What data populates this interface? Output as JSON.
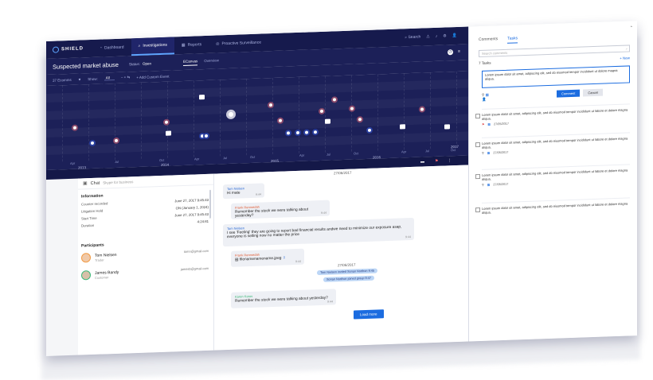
{
  "app": {
    "logo": "SHIELD"
  },
  "nav": [
    {
      "label": "Dashboard",
      "icon": "gauge-icon"
    },
    {
      "label": "Investigations",
      "icon": "search-icon"
    },
    {
      "label": "Reports",
      "icon": "chart-icon"
    },
    {
      "label": "Proactive Surveillance",
      "icon": "radar-icon"
    }
  ],
  "topright": {
    "search": "Search"
  },
  "header": {
    "title": "Suspected market abuse",
    "status_label": "Status:",
    "status_value": "Open",
    "tabs": [
      "ECanvas",
      "Overview"
    ]
  },
  "filters": {
    "ecomms": "37 Ecomms",
    "show": "Show:",
    "show_value": "All",
    "add": "+ Add Custom Event"
  },
  "timeline": {
    "months": [
      "Apr",
      "Jul",
      "Oct",
      "Jan",
      "Apr",
      "Jul",
      "Oct",
      "Jan",
      "Apr",
      "Jul",
      "Oct",
      "Jan",
      "Apr",
      "Jul",
      "Oct",
      "Jan",
      "Apr",
      "Jul",
      "Oct",
      "Jan",
      "Apr"
    ],
    "years": [
      "2013",
      "2014",
      "2015",
      "2016",
      "2017"
    ]
  },
  "chat": {
    "title": "Chat",
    "subtitle": "Skype for business"
  },
  "info": {
    "heading": "Information",
    "rows": [
      {
        "k": "Counter recorded",
        "v": "June 27, 2017 9:45:43"
      },
      {
        "k": "Litigation Hold",
        "v": "ON (January 1, 2024)"
      },
      {
        "k": "Start Time",
        "v": "June 27, 2017 9:45:43"
      },
      {
        "k": "Duration",
        "v": "4:24:81"
      }
    ]
  },
  "participants": {
    "heading": "Participants",
    "people": [
      {
        "name": "Tom Nielsen",
        "role": "Trader",
        "email": "tomn@gmail.com"
      },
      {
        "name": "James Bandy",
        "role": "Customer",
        "email": "jamesb@gmail.com"
      }
    ]
  },
  "messages": {
    "date1": "27/06/2017",
    "date2": "27/06/2017",
    "items": [
      {
        "who": "Tom Nielsen",
        "text": "Hi mate",
        "time": "9:44"
      },
      {
        "who": "Frank Renmedah",
        "text": "Remember the stock we were talking about yesterday?",
        "time": "9:44"
      },
      {
        "who": "Tom Nielsen",
        "text": "I see 'Feeling' they are going to report bad financial results andwe need to minimize our exposure asap, everyone is selling now no matter the price",
        "time": "9:44"
      },
      {
        "who": "Frank Renmedah",
        "text": "filenamenamename.jpeg",
        "time": "9:44"
      },
      {
        "who": "Karen Koros",
        "text": "Remember the stock we were talking about yesterday?",
        "time": "9:44"
      }
    ],
    "tags": [
      "Tom Nielsen invited Sonan Northon 9:45",
      "Sonan Northon joined group 9:47"
    ],
    "load_more": "Load more"
  },
  "side": {
    "tabs": [
      "Comments",
      "Tasks"
    ],
    "search_placeholder": "Search comments",
    "tasks_heading": "7 Tasks",
    "new": "+ New",
    "editor_text": "Lorem ipsum dolor sit amet, adipiscing elit, sed do eiusmod tempor incididunt ut dolore magna aliqua.",
    "comment_btn": "Comment",
    "cancel_btn": "Cancel",
    "tasks": [
      {
        "text": "Lorem ipsum dolor sit amet, adipiscing elit, sed do eiusmod tempor incididunt ut labore et dolore magna aliqua.",
        "date": "27/05/2017"
      },
      {
        "text": "Lorem ipsum dolor sit amet, adipiscing elit, sed do eiusmod tempor incididunt ut labore et dolore magna aliqua.",
        "date": "27/05/2017"
      },
      {
        "text": "Lorem ipsum dolor sit amet, adipiscing elit, sed do eiusmod tempor incididunt ut labore et dolore magna aliqua.",
        "date": "27/05/2017"
      },
      {
        "text": "Lorem ipsum dolor sit amet, adipiscing elit, sed do eiusmod tempor incididunt ut labore et dolore magna aliqua.",
        "date": ""
      }
    ]
  }
}
